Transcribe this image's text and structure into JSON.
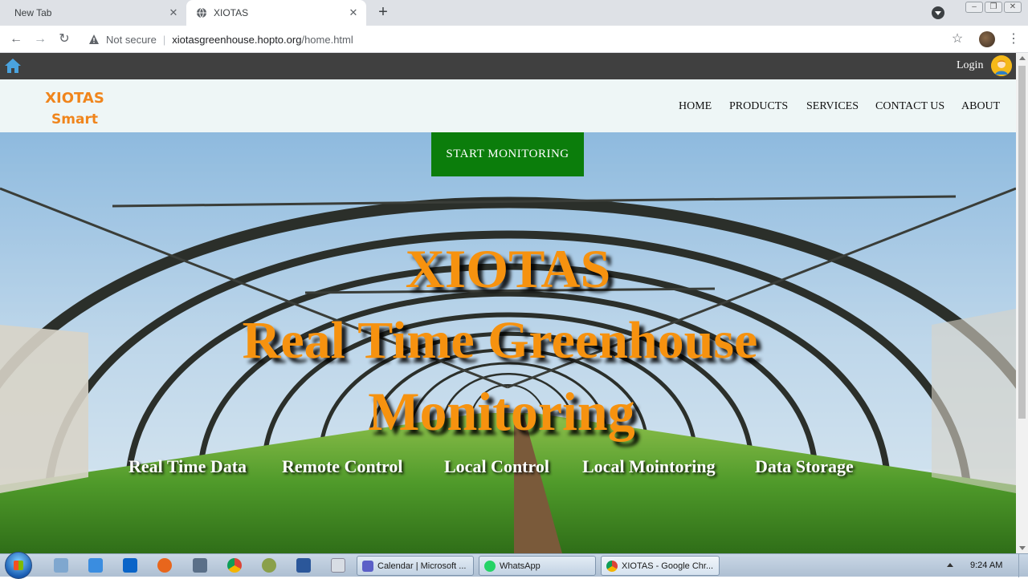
{
  "browser": {
    "tabs": [
      {
        "title": "New Tab",
        "active": false
      },
      {
        "title": "XIOTAS",
        "active": true
      }
    ],
    "security_label": "Not secure",
    "url_host": "xiotasgreenhouse.hopto.org",
    "url_path": "/home.html",
    "icons": [
      "back-icon",
      "forward-icon",
      "reload-icon",
      "warning-icon",
      "star-icon",
      "profile-icon",
      "menu-icon"
    ]
  },
  "site": {
    "login_label": "Login",
    "brand_line1": "XIOTAS",
    "brand_line2": "Smart Greenhouse",
    "nav": [
      "HOME",
      "PRODUCTS",
      "SERVICES",
      "CONTACT US",
      "ABOUT"
    ],
    "cta_label": "START MONITORING",
    "hero_line1": "XIOTAS",
    "hero_line2": "Real Time Greenhouse",
    "hero_line3": "Monitoring",
    "features": [
      "Real Time Data",
      "Remote Control",
      "Local Control",
      "Local Mointoring",
      "Data Storage"
    ],
    "colors": {
      "accent": "#f6920f",
      "cta": "#0b7d0b",
      "topbar": "#404040",
      "navbar": "#eef6f6"
    }
  },
  "taskbar": {
    "tasks": [
      "Calendar | Microsoft ...",
      "WhatsApp",
      "XIOTAS - Google Chr..."
    ],
    "clock": "9:24 AM"
  }
}
